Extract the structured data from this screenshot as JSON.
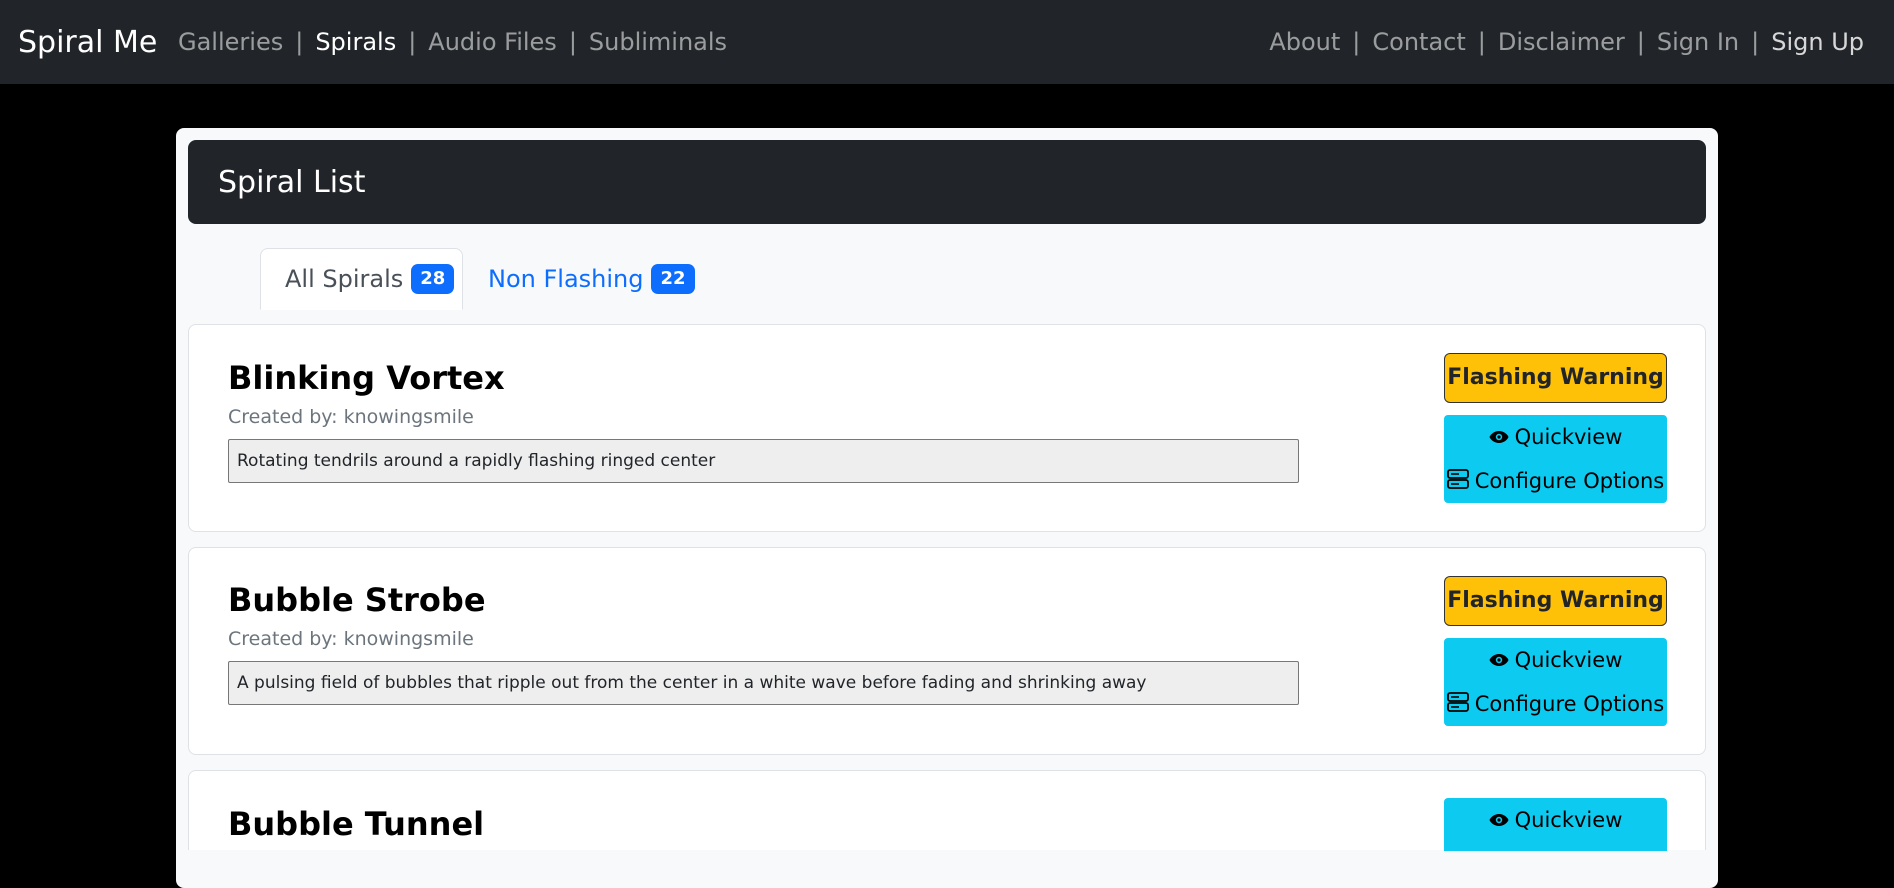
{
  "navbar": {
    "brand": "Spiral Me",
    "left_links": [
      "Galleries",
      "Spirals",
      "Audio Files",
      "Subliminals"
    ],
    "right_links": [
      "About",
      "Contact",
      "Disclaimer",
      "Sign In",
      "Sign Up"
    ],
    "separator": "|"
  },
  "header": {
    "title": "Spiral List"
  },
  "tabs": [
    {
      "label": "All Spirals",
      "count": "28"
    },
    {
      "label": "Non Flashing",
      "count": "22"
    }
  ],
  "items": [
    {
      "title": "Blinking Vortex",
      "creator": "Created by: knowingsmile",
      "description": "Rotating tendrils around a rapidly flashing ringed center",
      "warning": "Flashing Warning",
      "quickview": "Quickview",
      "configure": "Configure Options"
    },
    {
      "title": "Bubble Strobe",
      "creator": "Created by: knowingsmile",
      "description": "A pulsing field of bubbles that ripple out from the center in a white wave before fading and shrinking away",
      "warning": "Flashing Warning",
      "quickview": "Quickview",
      "configure": "Configure Options"
    },
    {
      "title": "Bubble Tunnel",
      "quickview": "Quickview"
    }
  ],
  "icons": {
    "eye": "eye-icon",
    "config": "server-icon"
  },
  "colors": {
    "nav": "#212529",
    "primary": "#0d6efd",
    "warning": "#ffc107",
    "info": "#0dcaf0"
  }
}
